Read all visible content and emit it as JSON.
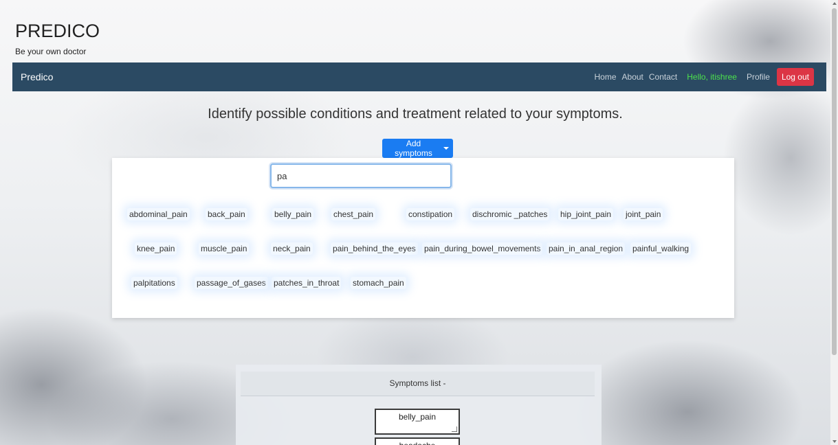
{
  "brand": {
    "title": "PREDICO",
    "subtitle": "Be your own doctor"
  },
  "navbar": {
    "brand": "Predico",
    "links": [
      "Home",
      "About",
      "Contact"
    ],
    "greeting": "Hello, itishree",
    "profile": "Profile",
    "logout": "Log out"
  },
  "main": {
    "headline": "Identify possible conditions and treatment related to your symptoms.",
    "add_button": "Add symptoms"
  },
  "dropdown": {
    "search_value": "pa",
    "items": [
      "abdominal_pain",
      "back_pain",
      "belly_pain",
      "chest_pain",
      "constipation",
      "dischromic _patches",
      "hip_joint_pain",
      "joint_pain",
      "knee_pain",
      "muscle_pain",
      "neck_pain",
      "pain_behind_the_eyes",
      "pain_during_bowel_movements",
      "pain_in_anal_region",
      "painful_walking",
      "palpitations",
      "passage_of_gases",
      "patches_in_throat",
      "stomach_pain"
    ]
  },
  "symptoms_list": {
    "header": "Symptoms list -",
    "entries": [
      "belly_pain",
      "headache"
    ]
  },
  "colors": {
    "navbar_bg": "#2b4a63",
    "accent_blue": "#1a7cf2",
    "danger_red": "#dc3545",
    "greeting_green": "#4ce24c"
  }
}
